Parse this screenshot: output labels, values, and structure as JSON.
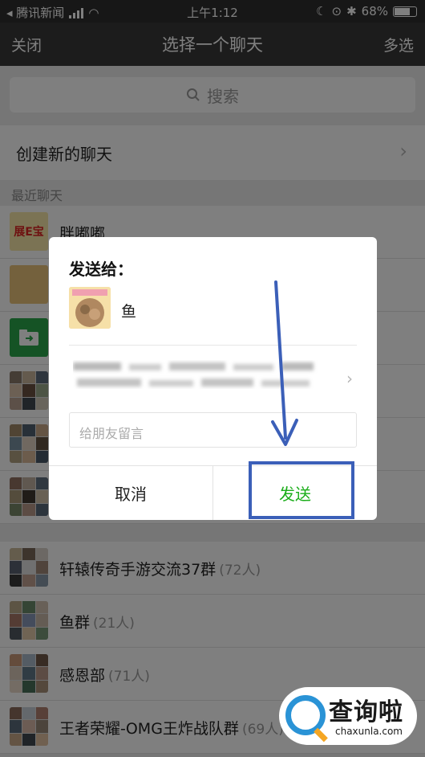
{
  "status_bar": {
    "back_app": "◂ 腾讯新闻",
    "time": "上午1:12",
    "battery": "68%"
  },
  "nav": {
    "close": "关闭",
    "title": "选择一个聊天",
    "multi_select": "多选"
  },
  "search": {
    "placeholder": "搜索"
  },
  "new_chat": {
    "label": "创建新的聊天"
  },
  "recent": {
    "section_label": "最近聊天",
    "chats": [
      {
        "name": "胖嘟嘟",
        "count": ""
      },
      {
        "name": "",
        "count": ""
      },
      {
        "name": "",
        "count": ""
      },
      {
        "name": "",
        "count": ""
      },
      {
        "name": "",
        "count": ""
      },
      {
        "name": "",
        "count": ""
      },
      {
        "name": "轩辕传奇手游交流37群",
        "count": "(72人)"
      },
      {
        "name": "鱼群",
        "count": "(21人)"
      },
      {
        "name": "感恩部",
        "count": "(71人)"
      },
      {
        "name": "王者荣耀-OMG王炸战队群",
        "count": "(69人)"
      }
    ]
  },
  "dialog": {
    "heading": "发送给：",
    "recipient_name": "鱼",
    "message_placeholder": "给朋友留言",
    "cancel": "取消",
    "send": "发送"
  },
  "watermark": {
    "title": "查询啦",
    "url": "chaxunla.com"
  },
  "colors": {
    "nav_bg": "#393939",
    "send_green": "#1aad19",
    "annotation_blue": "#3b5fb8"
  }
}
